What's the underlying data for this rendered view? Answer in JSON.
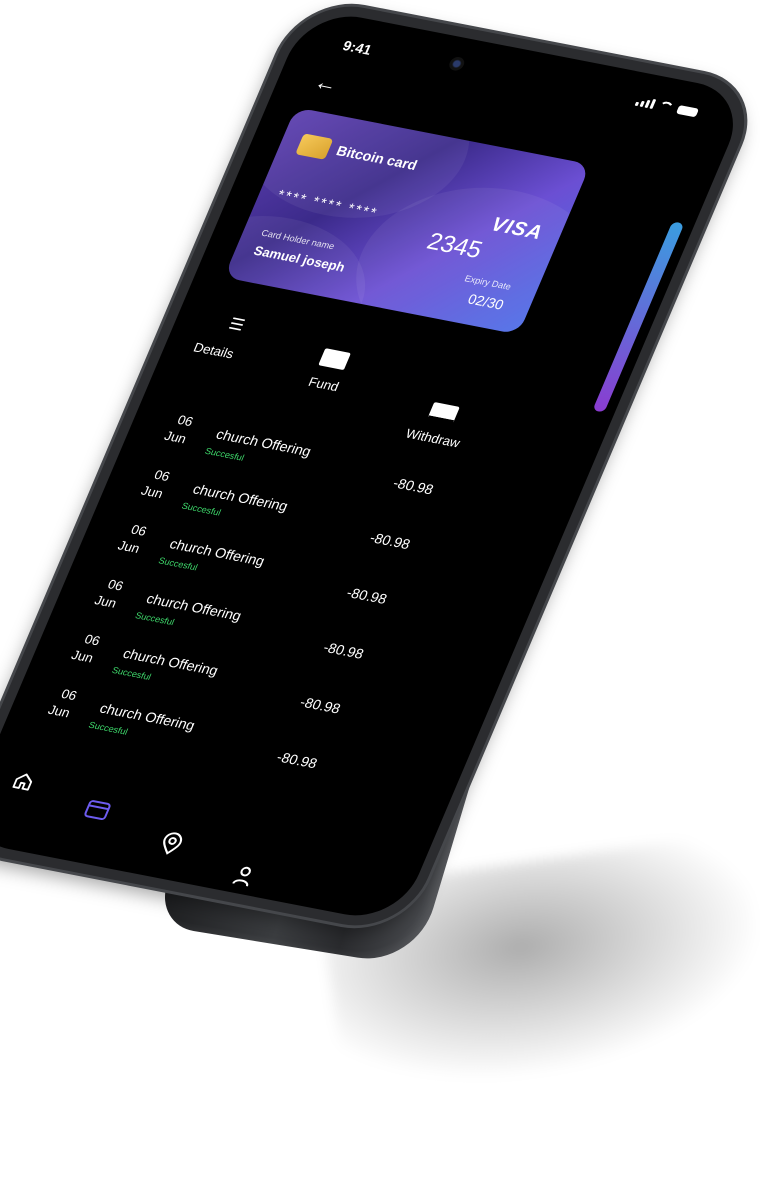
{
  "status": {
    "time": "9:41"
  },
  "card": {
    "name": "Bitcoin card",
    "brand": "VISA",
    "masked_number": "**** **** ****",
    "last4": "2345",
    "holder_label": "Card Holder name",
    "holder_name": "Samuel joseph",
    "expiry_label": "Expiry Date",
    "expiry": "02/30"
  },
  "actions": {
    "details": "Details",
    "fund": "Fund",
    "withdraw": "Withdraw"
  },
  "transactions": [
    {
      "day": "06",
      "month": "Jun",
      "title": "church Offering",
      "status": "Succesful"
    },
    {
      "day": "06",
      "month": "Jun",
      "title": "church Offering",
      "status": "Succesful"
    },
    {
      "day": "06",
      "month": "Jun",
      "title": "church Offering",
      "status": "Succesful"
    },
    {
      "day": "06",
      "month": "Jun",
      "title": "church Offering",
      "status": "Succesful"
    },
    {
      "day": "06",
      "month": "Jun",
      "title": "church Offering",
      "status": "Succesful"
    },
    {
      "day": "06",
      "month": "Jun",
      "title": "church Offering",
      "status": "Succesful"
    }
  ],
  "amounts": [
    "-80.98",
    "-80.98",
    "-80.98",
    "-80.98",
    "-80.98",
    "-80.98"
  ],
  "nav": [
    "home-icon",
    "card-icon",
    "location-icon",
    "profile-icon"
  ],
  "colors": {
    "accent": "#6d5cf0",
    "success": "#3ed96b",
    "card_start": "#5d3fb0",
    "card_end": "#4d6fe8"
  }
}
